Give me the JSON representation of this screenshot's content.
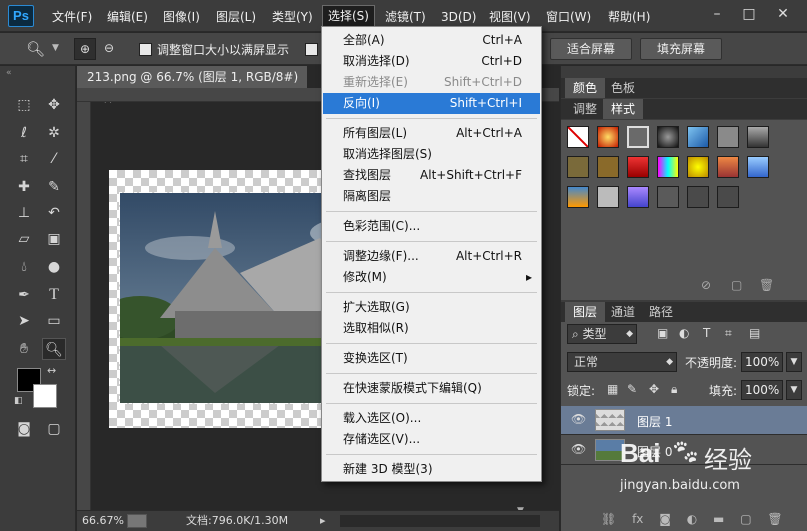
{
  "app": {
    "logo": "Ps"
  },
  "menubar": {
    "items": [
      "文件(F)",
      "编辑(E)",
      "图像(I)",
      "图层(L)",
      "类型(Y)",
      "选择(S)",
      "滤镜(T)",
      "3D(D)",
      "视图(V)",
      "窗口(W)",
      "帮助(H)"
    ],
    "selected_index": 5,
    "window_buttons": [
      "–",
      "□",
      "✕"
    ]
  },
  "options": {
    "checkbox_label": "调整窗口大小以满屏显示",
    "fit_screen": "适合屏幕",
    "fill_screen": "填充屏幕"
  },
  "document": {
    "tab_title": "213.png @ 66.7% (图层 1, RGB/8#) *",
    "tab_close": "×",
    "zoom": "66.67%",
    "doc_info": "文档:796.0K/1.30M"
  },
  "select_menu": {
    "items": [
      {
        "label": "全部(A)",
        "shortcut": "Ctrl+A"
      },
      {
        "label": "取消选择(D)",
        "shortcut": "Ctrl+D"
      },
      {
        "label": "重新选择(E)",
        "shortcut": "Shift+Ctrl+D",
        "disabled": true
      },
      {
        "label": "反向(I)",
        "shortcut": "Shift+Ctrl+I",
        "highlighted": true
      },
      {
        "label": "所有图层(L)",
        "shortcut": "Alt+Ctrl+A"
      },
      {
        "label": "取消选择图层(S)",
        "shortcut": ""
      },
      {
        "label": "查找图层",
        "shortcut": "Alt+Shift+Ctrl+F"
      },
      {
        "label": "隔离图层",
        "shortcut": ""
      },
      {
        "label": "色彩范围(C)...",
        "shortcut": ""
      },
      {
        "label": "调整边缘(F)...",
        "shortcut": "Alt+Ctrl+R"
      },
      {
        "label": "修改(M)",
        "shortcut": "",
        "submenu": true
      },
      {
        "label": "扩大选取(G)",
        "shortcut": ""
      },
      {
        "label": "选取相似(R)",
        "shortcut": ""
      },
      {
        "label": "变换选区(T)",
        "shortcut": ""
      },
      {
        "label": "在快速蒙版模式下编辑(Q)",
        "shortcut": ""
      },
      {
        "label": "载入选区(O)...",
        "shortcut": ""
      },
      {
        "label": "存储选区(V)...",
        "shortcut": ""
      },
      {
        "label": "新建 3D 模型(3)",
        "shortcut": ""
      }
    ],
    "submenu_arrow": "▸"
  },
  "panels": {
    "color_tabs": [
      "颜色",
      "色板"
    ],
    "style_tabs": [
      "调整",
      "样式"
    ],
    "layer_tabs": [
      "图层",
      "通道",
      "路径"
    ],
    "filter_kind": "类型",
    "blend_mode": "正常",
    "opacity_label": "不透明度:",
    "opacity_value": "100%",
    "lock_label": "锁定:",
    "fill_label": "填充:",
    "fill_value": "100%",
    "layers": [
      {
        "name": "图层 1",
        "selected": true
      },
      {
        "name": "图层 0",
        "selected": false
      }
    ]
  },
  "watermark": {
    "text": "jingyan.baidu.com",
    "brand": "Bai",
    "brand2": "经验"
  },
  "colors": {
    "accent": "#2a7ad6",
    "menu_bg": "#f0f0f0",
    "panel_bg": "#3c3c3c"
  }
}
